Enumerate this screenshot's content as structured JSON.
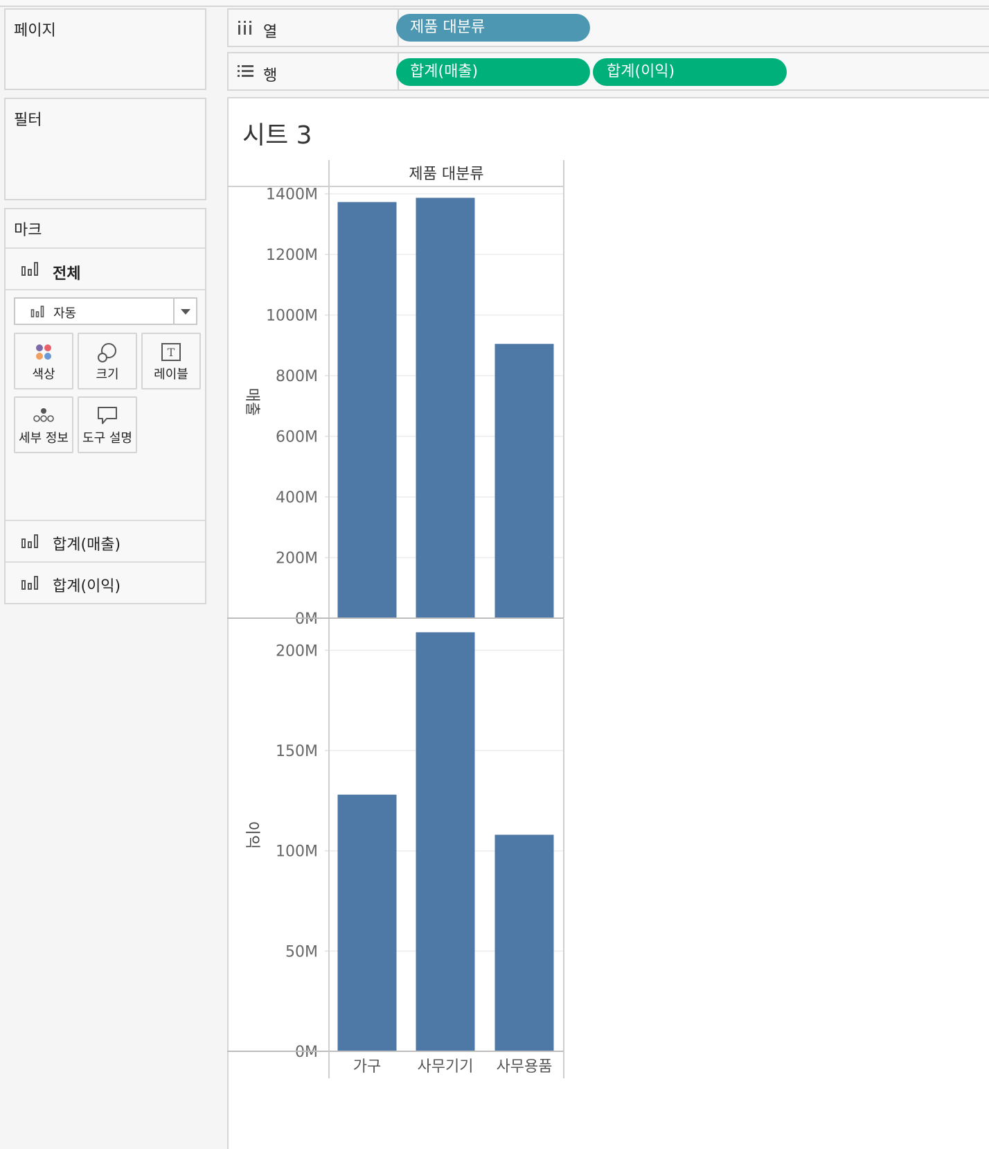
{
  "panels": {
    "pages_title": "페이지",
    "filters_title": "필터",
    "marks": {
      "title": "마크",
      "all_label": "전체",
      "mark_type": "자동",
      "cards": [
        "색상",
        "크기",
        "레이블",
        "세부 정보",
        "도구 설명"
      ],
      "label_card_glyph": "T",
      "measures": [
        "합계(매출)",
        "합계(이익)"
      ]
    }
  },
  "shelves": {
    "columns": {
      "label": "열",
      "pills": [
        "제품 대분류"
      ]
    },
    "rows": {
      "label": "행",
      "pills": [
        "합계(매출)",
        "합계(이익)"
      ]
    }
  },
  "colors": {
    "dimension_pill": "#4d97b3",
    "measure_pill": "#00b07a",
    "bar": "#4e79a7"
  },
  "sheet": {
    "title": "시트 3",
    "header": "제품 대분류"
  },
  "chart_data": [
    {
      "type": "bar",
      "categories": [
        "가구",
        "사무기기",
        "사무용품"
      ],
      "values": [
        1373,
        1387,
        905
      ],
      "ylabel": "매출",
      "ylim": [
        0,
        1420
      ],
      "yticks": [
        "0M",
        "200M",
        "400M",
        "600M",
        "800M",
        "1000M",
        "1200M",
        "1400M"
      ],
      "ytick_values": [
        0,
        200,
        400,
        600,
        800,
        1000,
        1200,
        1400
      ],
      "grid": true
    },
    {
      "type": "bar",
      "categories": [
        "가구",
        "사무기기",
        "사무용품"
      ],
      "values": [
        128,
        209,
        108
      ],
      "ylabel": "이익",
      "ylim": [
        0,
        215
      ],
      "yticks": [
        "0M",
        "50M",
        "100M",
        "150M",
        "200M"
      ],
      "ytick_values": [
        0,
        50,
        100,
        150,
        200
      ],
      "grid": true
    }
  ]
}
